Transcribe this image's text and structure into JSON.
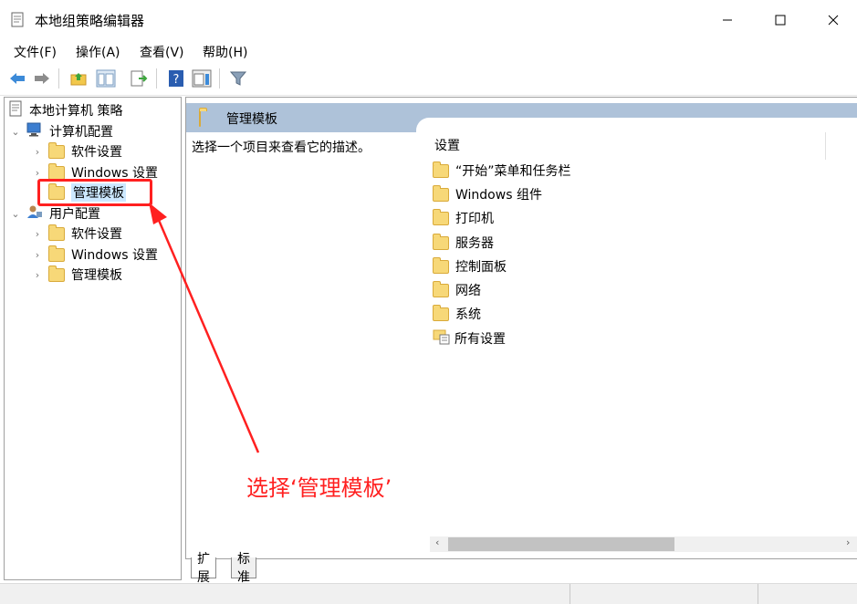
{
  "window": {
    "title": "本地组策略编辑器"
  },
  "menu": [
    "文件(F)",
    "操作(A)",
    "查看(V)",
    "帮助(H)"
  ],
  "toolbar": {
    "icons": [
      "back-arrow-icon",
      "forward-arrow-icon",
      "up-folder-icon",
      "show-hide-tree-icon",
      "export-list-icon",
      "help-icon",
      "show-hide-action-pane-icon",
      "filter-icon"
    ]
  },
  "tree": {
    "root": "本地计算机 策略",
    "computer_config": "计算机配置",
    "user_config": "用户配置",
    "software_settings": "软件设置",
    "windows_settings": "Windows 设置",
    "admin_templates": "管理模板"
  },
  "right": {
    "header_title": "管理模板",
    "description": "选择一个项目来查看它的描述。",
    "column_header": "设置",
    "items": [
      {
        "label": "“开始”菜单和任务栏",
        "icon": "folder-icon"
      },
      {
        "label": "Windows 组件",
        "icon": "folder-icon"
      },
      {
        "label": "打印机",
        "icon": "folder-icon"
      },
      {
        "label": "服务器",
        "icon": "folder-icon"
      },
      {
        "label": "控制面板",
        "icon": "folder-icon"
      },
      {
        "label": "网络",
        "icon": "folder-icon"
      },
      {
        "label": "系统",
        "icon": "folder-icon"
      },
      {
        "label": "所有设置",
        "icon": "all-settings-icon"
      }
    ]
  },
  "tabs": [
    "扩展",
    "标准"
  ],
  "annotation": {
    "text": "选择‘管理模板’",
    "color": "#ff2020"
  },
  "colors": {
    "header_bar": "#aec2d9",
    "selection": "#cce8ff",
    "folder": "#f7d878"
  }
}
